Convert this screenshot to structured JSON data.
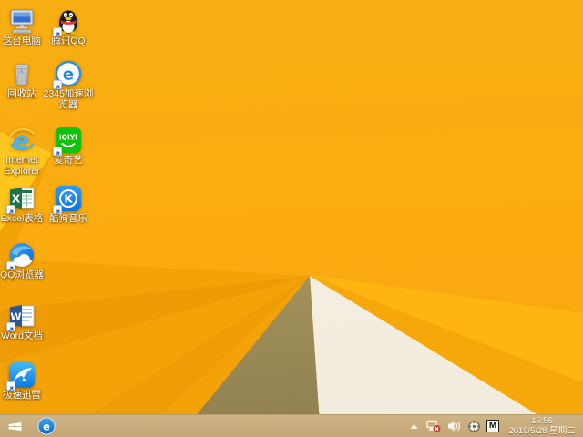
{
  "desktop": {
    "icons": [
      {
        "id": "this-pc",
        "label": "这台电脑",
        "shortcut": false
      },
      {
        "id": "tencent-qq",
        "label": "腾讯QQ",
        "shortcut": true
      },
      {
        "id": "recycle-bin",
        "label": "回收站",
        "shortcut": false
      },
      {
        "id": "browser-2345",
        "label": "2345加速浏览器",
        "label_lines": [
          "2345加速浏",
          "览器"
        ],
        "shortcut": true
      },
      {
        "id": "internet-explorer",
        "label": "Internet Explorer",
        "label_lines": [
          "Internet",
          "Explorer"
        ],
        "shortcut": false
      },
      {
        "id": "iqiyi",
        "label": "爱奇艺",
        "shortcut": true
      },
      {
        "id": "excel",
        "label": "Excel表格",
        "shortcut": true
      },
      {
        "id": "kugou",
        "label": "酷狗音乐",
        "shortcut": true
      },
      {
        "id": "qq-browser",
        "label": "QQ浏览器",
        "shortcut": true
      },
      {
        "id": "word",
        "label": "Word文档",
        "shortcut": true
      },
      {
        "id": "xunlei",
        "label": "极速迅雷",
        "shortcut": true
      }
    ]
  },
  "taskbar": {
    "tray": {
      "input_method": "M",
      "time": "15:56",
      "date": "2019/5/28 星期二"
    }
  },
  "icon_glyphs": {
    "e2345": "e",
    "ie_e": "e",
    "iqiyi_text": "iQIYI",
    "excel_x": "X",
    "kugou_k": "K",
    "word_w": "W"
  },
  "colors": {
    "wallpaper_base": "#f9ac10",
    "wallpaper_band": "#feb512",
    "wallpaper_cream": "#f4efe2",
    "wallpaper_tan": "#ab9a61",
    "taskbar": "#c8ab7c",
    "accent_blue": "#1d86e6",
    "iqiyi_green": "#0fc20a"
  }
}
